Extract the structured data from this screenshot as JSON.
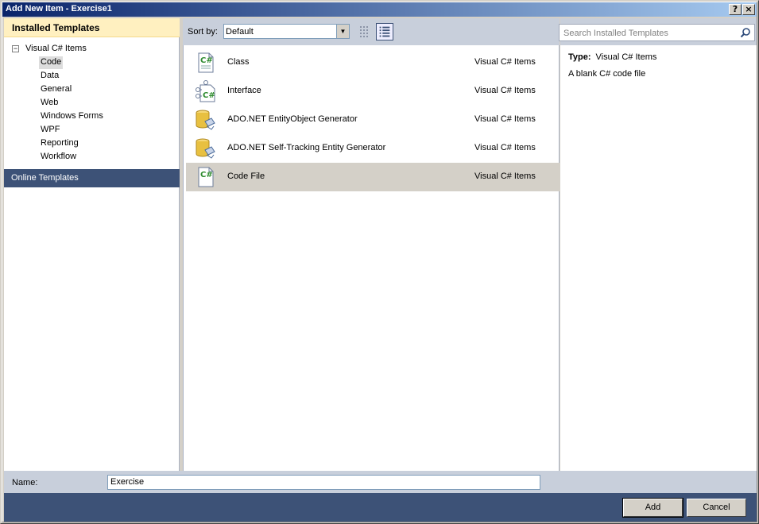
{
  "window": {
    "title": "Add New Item - Exercise1",
    "help_glyph": "?",
    "close_glyph": "×"
  },
  "sidebar": {
    "installed_header": "Installed Templates",
    "root_label": "Visual C# Items",
    "root_expander": "−",
    "items": [
      {
        "label": "Code",
        "selected": true
      },
      {
        "label": "Data",
        "selected": false
      },
      {
        "label": "General",
        "selected": false
      },
      {
        "label": "Web",
        "selected": false
      },
      {
        "label": "Windows Forms",
        "selected": false
      },
      {
        "label": "WPF",
        "selected": false
      },
      {
        "label": "Reporting",
        "selected": false
      },
      {
        "label": "Workflow",
        "selected": false
      }
    ],
    "online_label": "Online Templates"
  },
  "toolbar": {
    "sort_label": "Sort by:",
    "sort_value": "Default",
    "search_placeholder": "Search Installed Templates"
  },
  "templates": [
    {
      "name": "Class",
      "type": "Visual C# Items",
      "icon": "csharp-class-icon",
      "selected": false
    },
    {
      "name": "Interface",
      "type": "Visual C# Items",
      "icon": "csharp-interface-icon",
      "selected": false
    },
    {
      "name": "ADO.NET EntityObject Generator",
      "type": "Visual C# Items",
      "icon": "database-generator-icon",
      "selected": false
    },
    {
      "name": "ADO.NET Self-Tracking Entity Generator",
      "type": "Visual C# Items",
      "icon": "database-generator-icon",
      "selected": false
    },
    {
      "name": "Code File",
      "type": "Visual C# Items",
      "icon": "csharp-code-file-icon",
      "selected": true
    }
  ],
  "details": {
    "type_label": "Type:",
    "type_value": "Visual C# Items",
    "description": "A blank C# code file"
  },
  "name_row": {
    "label": "Name:",
    "value": "Exercise"
  },
  "buttons": {
    "add": "Add",
    "cancel": "Cancel"
  },
  "colors": {
    "titlebar_start": "#0a246a",
    "panel_header": "#fff0c0",
    "navy": "#3d5277",
    "toolbar_bg": "#c8cfdb"
  }
}
